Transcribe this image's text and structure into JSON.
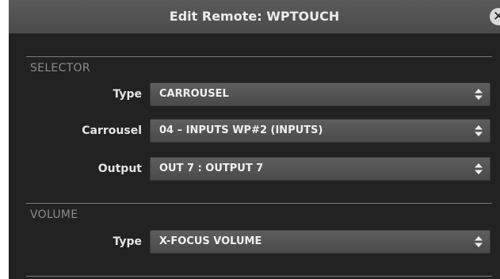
{
  "dialog": {
    "title": "Edit Remote: WPTOUCH",
    "close_icon": "close-icon"
  },
  "selector": {
    "title": "SELECTOR",
    "fields": [
      {
        "label": "Type",
        "value": "CARROUSEL"
      },
      {
        "label": "Carrousel",
        "value": "04 – INPUTS WP#2 (INPUTS)"
      },
      {
        "label": "Output",
        "value": "OUT 7 : OUTPUT 7"
      }
    ]
  },
  "volume": {
    "title": "VOLUME",
    "fields": [
      {
        "label": "Type",
        "value": "X-FOCUS VOLUME"
      }
    ]
  },
  "colors": {
    "background": "#222222",
    "titlebar": "#555555",
    "select": "#555555",
    "section_title": "#8b8b8b"
  }
}
